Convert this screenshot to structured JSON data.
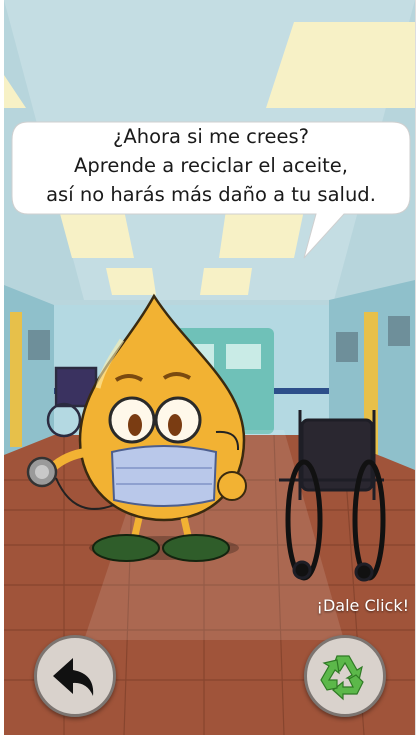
{
  "speech": {
    "lines": [
      "¿Ahora si me crees?",
      "Aprende a reciclar el aceite,",
      "así no harás más daño a tu salud."
    ]
  },
  "hint_label": "¡Dale Click!",
  "icons": {
    "back": "back-arrow-icon",
    "recycle": "recycle-icon"
  },
  "colors": {
    "drop": "#f2b233",
    "floor": "#a0543a",
    "recycle": "#5cb84a"
  }
}
